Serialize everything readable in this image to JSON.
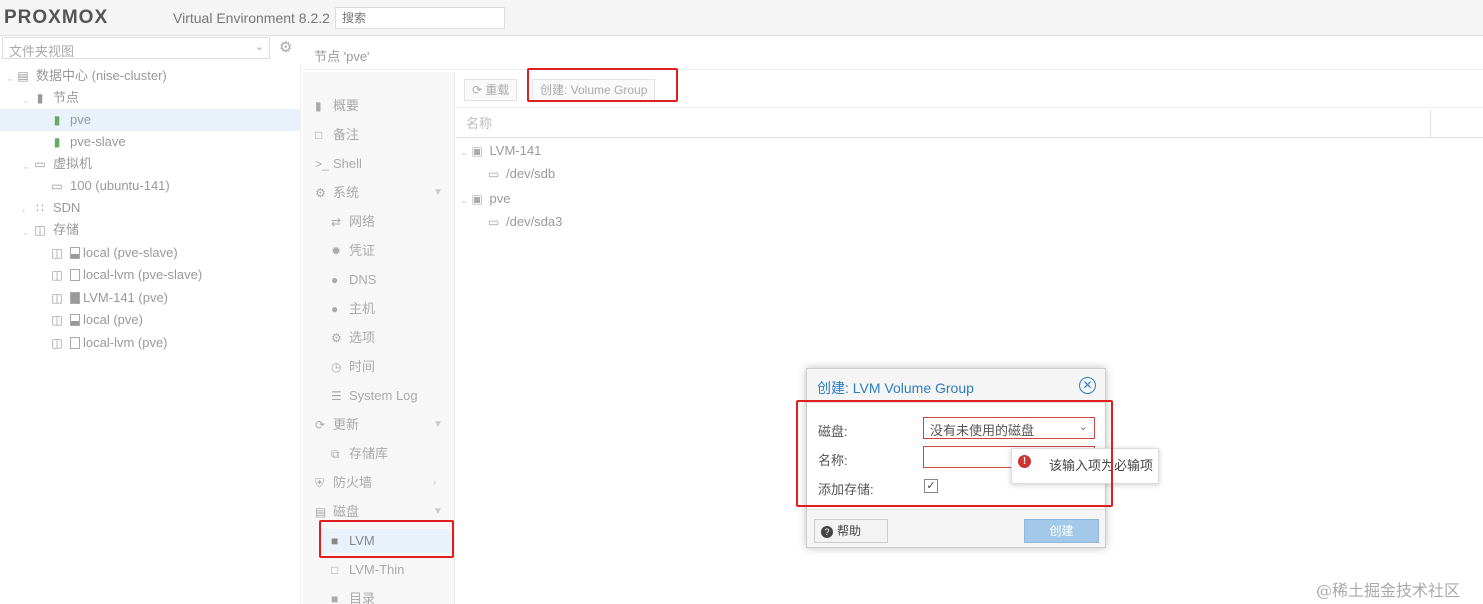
{
  "header": {
    "logo_text": "PROXMOX",
    "product": "Virtual Environment 8.2.2",
    "search_placeholder": "搜索"
  },
  "tree": {
    "view": "文件夹视图",
    "nodes": [
      {
        "label": "数据中心 (nise-cluster)",
        "icon": "datacenter-icon"
      },
      {
        "label": "节点",
        "icon": "server-icon"
      },
      {
        "label": "pve",
        "icon": "node-online-icon",
        "selected": true
      },
      {
        "label": "pve-slave",
        "icon": "node-online-icon"
      },
      {
        "label": "虚拟机",
        "icon": "monitor-icon"
      },
      {
        "label": "100 (ubuntu-141)",
        "icon": "vm-icon"
      },
      {
        "label": "SDN",
        "icon": "grid-icon"
      },
      {
        "label": "存储",
        "icon": "database-icon"
      },
      {
        "label": "local (pve-slave)",
        "icon": "storage-icon"
      },
      {
        "label": "local-lvm (pve-slave)",
        "icon": "storage-icon"
      },
      {
        "label": "LVM-141 (pve)",
        "icon": "storage-icon"
      },
      {
        "label": "local (pve)",
        "icon": "storage-icon"
      },
      {
        "label": "local-lvm (pve)",
        "icon": "storage-icon"
      }
    ]
  },
  "node_title": "节点 'pve'",
  "menu": [
    {
      "label": "概要",
      "icon": "book-icon"
    },
    {
      "label": "备注",
      "icon": "note-icon"
    },
    {
      "label": "Shell",
      "icon": "terminal-icon"
    },
    {
      "label": "系统",
      "icon": "cogs-icon"
    },
    {
      "label": "网络",
      "icon": "exchange-icon"
    },
    {
      "label": "凭证",
      "icon": "certificate-icon"
    },
    {
      "label": "DNS",
      "icon": "globe-icon"
    },
    {
      "label": "主机",
      "icon": "globe-icon"
    },
    {
      "label": "选项",
      "icon": "gear-icon"
    },
    {
      "label": "时间",
      "icon": "clock-icon"
    },
    {
      "label": "System Log",
      "icon": "list-icon"
    },
    {
      "label": "更新",
      "icon": "refresh-icon"
    },
    {
      "label": "存储库",
      "icon": "files-icon"
    },
    {
      "label": "防火墙",
      "icon": "shield-icon"
    },
    {
      "label": "磁盘",
      "icon": "hdd-icon"
    },
    {
      "label": "LVM",
      "icon": "square-icon"
    },
    {
      "label": "LVM-Thin",
      "icon": "square-outline-icon"
    },
    {
      "label": "目录",
      "icon": "folder-icon"
    }
  ],
  "toolbar": {
    "reload": "重载",
    "create": "创建: Volume Group"
  },
  "grid": {
    "column_name": "名称",
    "rows": [
      {
        "label": "LVM-141",
        "icon": "volume-group-icon"
      },
      {
        "label": "/dev/sdb",
        "icon": "disk-icon"
      },
      {
        "label": "pve",
        "icon": "volume-group-icon"
      },
      {
        "label": "/dev/sda3",
        "icon": "disk-icon"
      }
    ]
  },
  "dialog": {
    "title": "创建: LVM Volume Group",
    "disk_label": "磁盘:",
    "disk_value": "没有未使用的磁盘",
    "name_label": "名称:",
    "name_value": "",
    "add_storage_label": "添加存储:",
    "add_storage_checked": true,
    "help": "帮助",
    "create": "创建",
    "tooltip": "该输入项为必输项"
  },
  "watermark": "@稀土掘金技术社区",
  "colors": {
    "brand": "#e57000",
    "accent": "#2d7cc1",
    "highlight": "#e02020"
  }
}
